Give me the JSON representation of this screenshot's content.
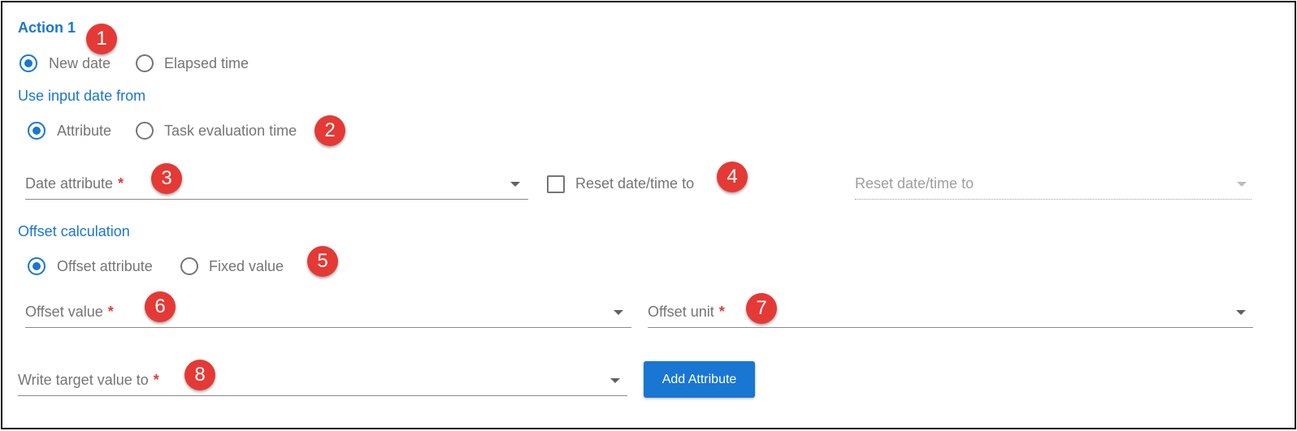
{
  "action": {
    "title": "Action 1"
  },
  "date_mode": {
    "options": [
      "New date",
      "Elapsed time"
    ],
    "selected": "New date"
  },
  "input_date": {
    "heading": "Use input date from",
    "options": [
      "Attribute",
      "Task evaluation time"
    ],
    "selected": "Attribute"
  },
  "date_attribute": {
    "label": "Date attribute",
    "required_mark": "*",
    "value": ""
  },
  "reset": {
    "checkbox_label": "Reset date/time to",
    "checked": false,
    "select_label": "Reset date/time to",
    "select_disabled": true
  },
  "offset": {
    "heading": "Offset calculation",
    "options": [
      "Offset attribute",
      "Fixed value"
    ],
    "selected": "Offset attribute",
    "value_label": "Offset value",
    "unit_label": "Offset unit",
    "required_mark": "*"
  },
  "target": {
    "label": "Write target value to",
    "required_mark": "*"
  },
  "add_attribute_button": "Add Attribute",
  "markers": [
    "1",
    "2",
    "3",
    "4",
    "5",
    "6",
    "7",
    "8"
  ],
  "colors": {
    "accent": "#1976d2",
    "required": "#e53935",
    "marker": "#e53935"
  }
}
